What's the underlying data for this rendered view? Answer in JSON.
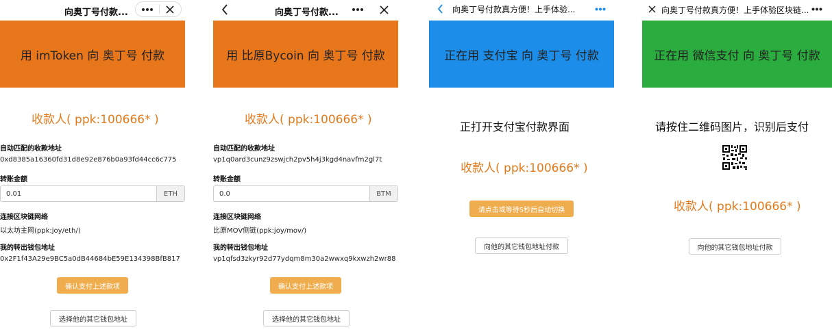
{
  "panel1": {
    "title": "向奥丁号付款...",
    "banner": "用 imToken 向 奥丁号 付款",
    "banner_color": "#e8771c",
    "payee": "收款人( ppk:100666* )",
    "address_label": "自动匹配的收款地址",
    "address_value": "0xd8385a16360fd31d8e92e876b0a93fd44cc6c775",
    "amount_label": "转账金额",
    "amount_value": "0.01",
    "amount_unit": "ETH",
    "network_label": "连接区块链网络",
    "network_value": "以太坊主网(ppk:joy/eth/)",
    "wallet_label": "我的转出钱包地址",
    "wallet_value": "0x2F1f43A29e9BC5a0dB44684bE59E134398BfB817",
    "confirm_button": "确认支付上述款项",
    "select_button": "选择他的其它钱包地址"
  },
  "panel2": {
    "title": "向奥丁号付款...",
    "banner": "用 比原Bycoin 向 奥丁号 付款",
    "banner_color": "#e8771c",
    "payee": "收款人( ppk:100666* )",
    "address_label": "自动匹配的收款地址",
    "address_value": "vp1q0ard3cunz9zswjch2pv5h4j3kgd4navfm2gl7t",
    "amount_label": "转账金额",
    "amount_value": "0.0",
    "amount_unit": "BTM",
    "network_label": "连接区块链网络",
    "network_value": "比原MOV侧链(ppk:joy/mov/)",
    "wallet_label": "我的转出钱包地址",
    "wallet_value": "vp1qfsd3zkyr92d77ydqm8m30a2wwxq9kxwzh2wr88",
    "confirm_button": "确认支付上述款项",
    "select_button": "选择他的其它钱包地址"
  },
  "panel3": {
    "title": "向奥丁号付款真方便！上手体验...",
    "banner": "正在用 支付宝 向 奥丁号 付款",
    "banner_color": "#1c8de8",
    "opening_text": "正打开支付宝付款界面",
    "payee": "收款人( ppk:100666* )",
    "wait_button": "请点击或等待5秒后自动切换",
    "other_button": "向他的其它钱包地址付款"
  },
  "panel4": {
    "title": "向奥丁号付款真方便！上手体验区块链...",
    "banner": "正在用 微信支付 向 奥丁号 付款",
    "banner_color": "#2aad3e",
    "instruction": "请按住二维码图片，识别后支付",
    "payee": "收款人( ppk:100666* )",
    "other_button": "向他的其它钱包地址付款"
  },
  "accent": "#e07a1c",
  "icons": [
    "more-icon",
    "close-icon",
    "back-icon",
    "qr-code-icon"
  ]
}
